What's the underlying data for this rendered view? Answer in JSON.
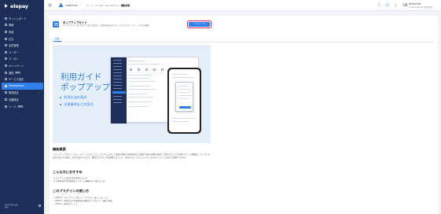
{
  "sidebar": {
    "brand": "elepay",
    "items": [
      {
        "label": "ダッシュボード",
        "icon": "dashboard-icon",
        "chevron": false,
        "badge": "",
        "active": false
      },
      {
        "label": "明細",
        "icon": "receipt-icon",
        "chevron": false,
        "badge": "",
        "active": false
      },
      {
        "label": "商品",
        "icon": "box-icon",
        "chevron": true,
        "badge": "",
        "active": false
      },
      {
        "label": "注文",
        "icon": "cart-icon",
        "chevron": false,
        "badge": "",
        "active": false
      },
      {
        "label": "会員管理",
        "icon": "users-icon",
        "chevron": true,
        "badge": "",
        "active": false
      },
      {
        "label": "ユーザー",
        "icon": "user-icon",
        "chevron": false,
        "badge": "",
        "active": false
      },
      {
        "label": "クーポン",
        "icon": "coupon-icon",
        "chevron": false,
        "badge": "",
        "active": false
      },
      {
        "label": "キャンペーン",
        "icon": "megaphone-icon",
        "chevron": false,
        "badge": "",
        "active": false
      },
      {
        "label": "通知",
        "icon": "bell-icon",
        "chevron": false,
        "badge": "BETA",
        "active": false
      },
      {
        "label": "サービス設定",
        "icon": "settings-icon",
        "chevron": true,
        "badge": "",
        "active": false
      },
      {
        "label": "Marketplace",
        "icon": "grid-icon",
        "chevron": false,
        "badge": "",
        "active": true
      },
      {
        "label": "開発設定",
        "icon": "code-icon",
        "chevron": true,
        "badge": "",
        "active": false
      },
      {
        "label": "店舗設定",
        "icon": "store-icon",
        "chevron": false,
        "badge": "",
        "active": false
      },
      {
        "label": "ツール",
        "icon": "tool-icon",
        "chevron": false,
        "badge": "BETA",
        "active": false
      }
    ],
    "footer_line1": "elepay株式会社",
    "footer_line2": "運用"
  },
  "topbar": {
    "tenant": "ELESTYLE",
    "breadcrumb": [
      "ホーム",
      "/",
      "UnitUB",
      "/",
      "Marketplace",
      "/",
      "機能詳細"
    ],
    "user_name": "ELESTYLE",
    "user_sub": "info@elestyle.jp 管理者権限"
  },
  "plugin": {
    "title": "ポップアップガイド",
    "description": "ユーザーのペースに合わせて決済の案内や、追加情報を表示することができるポップアップ方式の機能",
    "install_label": "インストール",
    "tab_label": "概要"
  },
  "banner": {
    "title_line1": "利用ガイド",
    "title_line2": "ポップアップ",
    "bullets": [
      "利用方法の案内",
      "注意事項などの案内"
    ]
  },
  "content": {
    "overview_title": "機能概要",
    "overview_text": "「ポップアップガイド」をインストールすることで、ユーザーに対して任意の項目や注意事項などを最大10枚の画像を使用して案内することが可能です。この機能は、ユーザーの決済プロセスの際に一度だけ表示されます。適切なガイダンスを提供することで、決済のスムーズさとユーザーエクスペリエンスの向上が期待できます。",
    "recommend_title": "こんな方におすすめ",
    "recommend_items": [
      "◎ ユーザーに決済方法を説明したい方",
      "◎ 注意事項や特記事項をユーザーに画像付きで伝えたい方"
    ],
    "howto_title": "このプラグインの使い方",
    "howto_items": [
      "• STEP 1：「ポップアップガイド」プラグインをインストール",
      "• STEP 2：利用方法や注意事項の画像をアップロード（最大10枚）",
      "• STEP 3：保存をクリック"
    ]
  }
}
